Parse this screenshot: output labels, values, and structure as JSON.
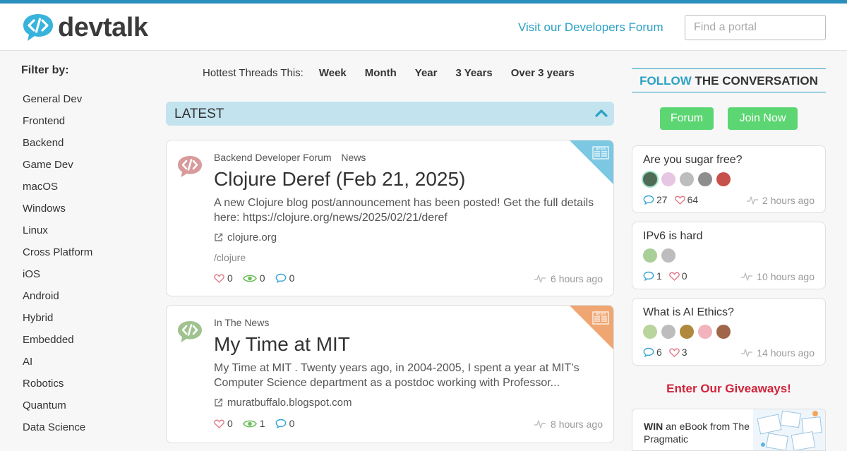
{
  "header": {
    "logo_text": "devtalk",
    "visit_link": "Visit our Developers Forum",
    "search_placeholder": "Find a portal",
    "accent_color": "#2a8fbd"
  },
  "sidebar": {
    "filter_title": "Filter by:",
    "items": [
      "General Dev",
      "Frontend",
      "Backend",
      "Game Dev",
      "macOS",
      "Windows",
      "Linux",
      "Cross Platform",
      "iOS",
      "Android",
      "Hybrid",
      "Embedded",
      "AI",
      "Robotics",
      "Quantum",
      "Data Science"
    ]
  },
  "hottest": {
    "label": "Hottest Threads This:",
    "options": [
      "Week",
      "Month",
      "Year",
      "3 Years",
      "Over 3 years"
    ]
  },
  "latest": {
    "label": "LATEST",
    "posts": [
      {
        "categories": [
          "Backend Developer Forum",
          "News"
        ],
        "title": "Clojure Deref (Feb 21, 2025)",
        "excerpt": "A new Clojure blog post/announcement has been posted! Get the full details here: https://clojure.org/news/2025/02/21/deref",
        "link": "clojure.org",
        "tag": "/clojure",
        "likes": "0",
        "views": "0",
        "comments": "0",
        "time": "6 hours ago",
        "corner_label": "NEWS",
        "corner_color": "#7cc8e3"
      },
      {
        "categories": [
          "In The News"
        ],
        "title": "My Time at MIT",
        "excerpt": "My Time at MIT . Twenty years ago, in 2004-2005, I spent a year at MIT’s Computer Science department as a postdoc working with Professor...",
        "link": "muratbuffalo.blogspot.com",
        "likes": "0",
        "views": "1",
        "comments": "0",
        "time": "8 hours ago",
        "corner_label": "NEWS",
        "corner_color": "#f0a673"
      }
    ]
  },
  "right": {
    "follow_highlight": "FOLLOW",
    "follow_rest": " THE CONVERSATION",
    "forum_button": "Forum",
    "join_button": "Join Now",
    "threads": [
      {
        "title": "Are you sugar free?",
        "comments": "27",
        "likes": "64",
        "time": "2 hours ago"
      },
      {
        "title": "IPv6 is hard",
        "comments": "1",
        "likes": "0",
        "time": "10 hours ago"
      },
      {
        "title": "What is AI Ethics?",
        "comments": "6",
        "likes": "3",
        "time": "14 hours ago"
      }
    ],
    "giveaways": "Enter Our Giveaways!",
    "promo_bold": "WIN",
    "promo_rest": " an eBook from The Pragmatic"
  }
}
